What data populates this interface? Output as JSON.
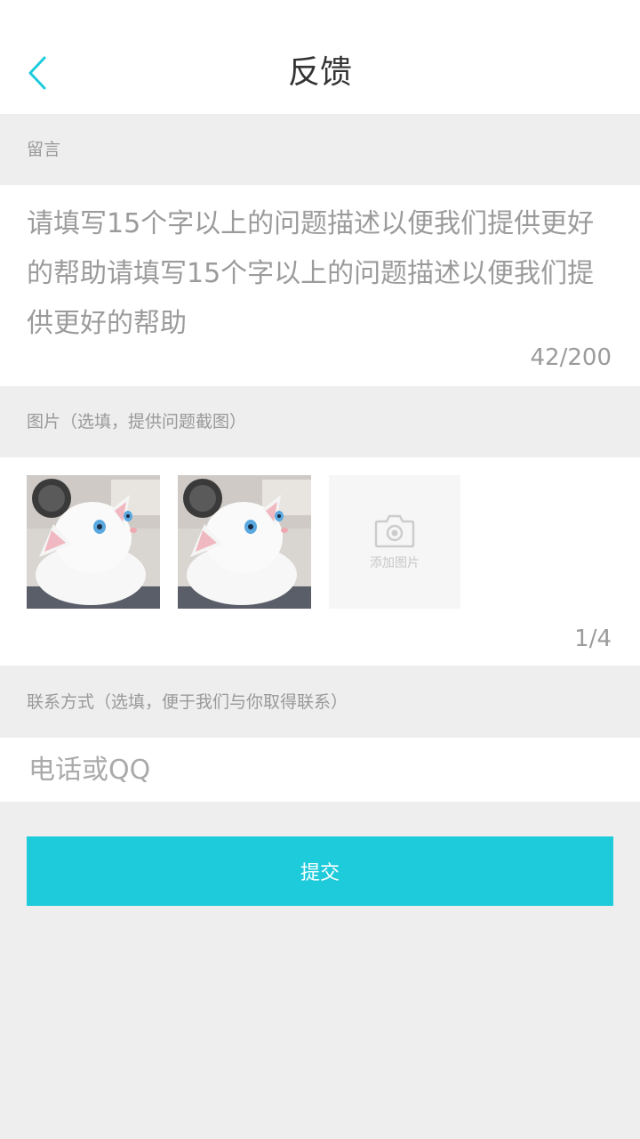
{
  "header": {
    "title": "反馈",
    "back_icon": "chevron-left-icon"
  },
  "message": {
    "label": "留言",
    "text": "请填写15个字以上的问题描述以便我们提供更好的帮助请填写15个字以上的问题描述以便我们提供更好的帮助",
    "counter": "42/200"
  },
  "images": {
    "label": "图片（选填，提供问题截图）",
    "thumbnails": [
      "white-cat-photo",
      "white-cat-photo"
    ],
    "add_label": "添加图片",
    "add_icon": "camera-icon",
    "counter": "1/4"
  },
  "contact": {
    "label": "联系方式（选填，便于我们与你取得联系）",
    "placeholder": "电话或QQ",
    "value": ""
  },
  "submit": {
    "label": "提交"
  },
  "colors": {
    "accent": "#1ecbdb",
    "background": "#eeeeee",
    "panel": "#ffffff",
    "muted_text": "#999999"
  }
}
